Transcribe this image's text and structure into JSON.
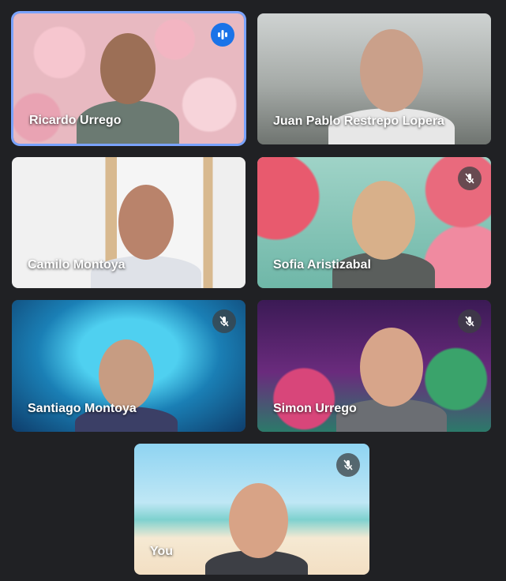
{
  "participants": [
    {
      "name": "Ricardo Urrego",
      "status": "speaking"
    },
    {
      "name": "Juan Pablo Restrepo Lopera",
      "status": "none"
    },
    {
      "name": "Camilo Montoya",
      "status": "none"
    },
    {
      "name": "Sofia Aristizabal",
      "status": "muted"
    },
    {
      "name": "Santiago Montoya",
      "status": "muted"
    },
    {
      "name": "Simon Urrego",
      "status": "muted"
    },
    {
      "name": "You",
      "status": "muted"
    }
  ],
  "icons": {
    "muted": "mic-off-icon",
    "speaking": "audio-level-icon"
  },
  "colors": {
    "background": "#202124",
    "active_speaker_border": "#7aa3ff",
    "speaking_badge": "#1a73e8"
  }
}
